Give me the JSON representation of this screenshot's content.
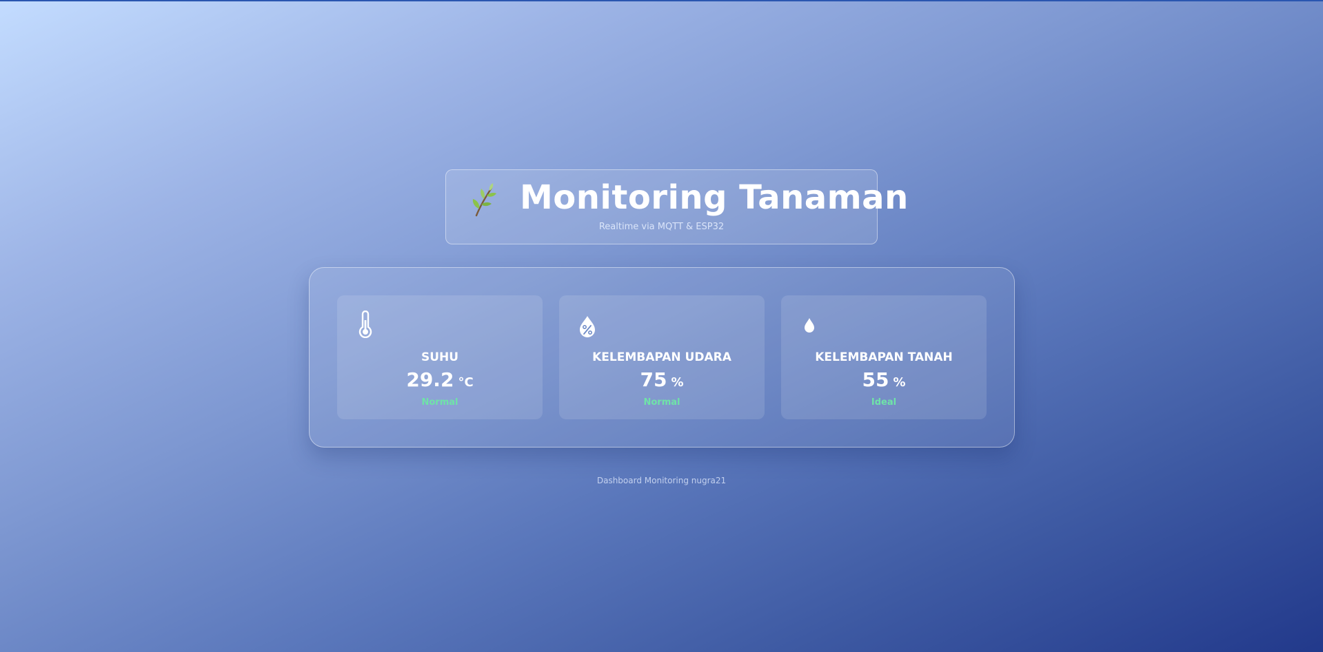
{
  "header": {
    "icon": "leaf-branch-icon",
    "title": "Monitoring Tanaman",
    "subtitle": "Realtime via MQTT & ESP32"
  },
  "sensors": [
    {
      "icon": "thermometer-icon",
      "label": "SUHU",
      "value": "29.2",
      "unit": "°C",
      "status": "Normal"
    },
    {
      "icon": "humidity-percent-icon",
      "label": "KELEMBAPAN UDARA",
      "value": "75",
      "unit": "%",
      "status": "Normal"
    },
    {
      "icon": "water-drop-icon",
      "label": "KELEMBAPAN TANAH",
      "value": "55",
      "unit": "%",
      "status": "Ideal"
    }
  ],
  "footer": {
    "text": "Dashboard Monitoring nugra21"
  },
  "colors": {
    "status_ok": "#6fe3a8",
    "text": "#ffffff",
    "background_start": "#c3dcff",
    "background_end": "#22398b"
  }
}
